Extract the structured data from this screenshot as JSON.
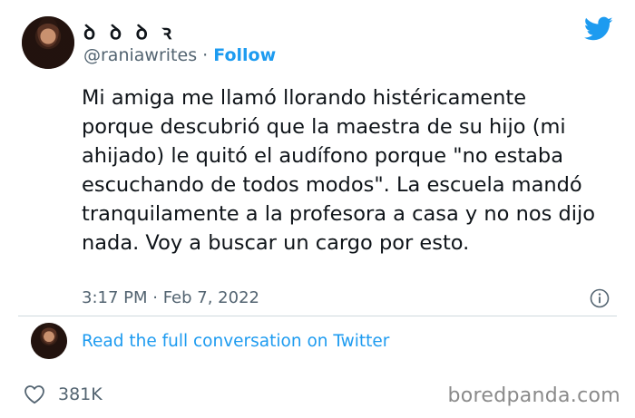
{
  "tweet": {
    "display_name": "ꝺ ꝺ ꝺ ꝛ",
    "handle": "@raniawrites",
    "separator": "·",
    "follow_label": "Follow",
    "text": "Mi amiga me llamó llorando histéricamente porque descubrió que la maestra de su hijo (mi ahijado) le quitó el audífono porque \"no estaba escuchando de todos modos\". La escuela mandó tranquilamente a la profesora a casa y no nos dijo nada. Voy a buscar un cargo por esto.",
    "timestamp": "3:17 PM · Feb 7, 2022",
    "read_more_label": "Read the full conversation on Twitter",
    "likes": "381K"
  },
  "watermark": "boredpanda.com",
  "icons": {
    "brand": "twitter-bird-icon",
    "info": "info-icon",
    "like": "heart-icon"
  },
  "colors": {
    "accent": "#1d9bf0",
    "text": "#0f1419",
    "muted": "#536471"
  }
}
